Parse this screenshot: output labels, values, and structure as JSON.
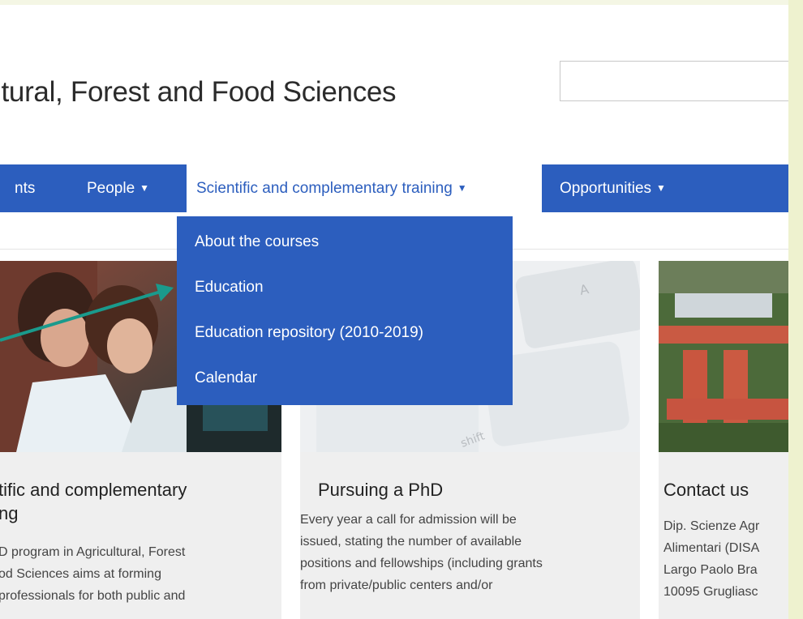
{
  "header": {
    "title": "ltural, Forest and Food Sciences",
    "search_placeholder": ""
  },
  "nav": {
    "items": [
      {
        "label": "nts"
      },
      {
        "label": "People"
      },
      {
        "label": "Scientific and complementary training"
      },
      {
        "label": "Opportunities"
      }
    ]
  },
  "dropdown": {
    "items": [
      {
        "label": "About the courses"
      },
      {
        "label": "Education"
      },
      {
        "label": "Education repository (2010-2019)"
      },
      {
        "label": "Calendar"
      }
    ]
  },
  "cards": [
    {
      "title_line1": "tific and complementary",
      "title_line2": "ng",
      "text": [
        "D program in Agricultural, Forest",
        "od Sciences aims at forming",
        "professionals for both public and"
      ]
    },
    {
      "title": "Pursuing a PhD",
      "text": [
        "Every year a call for admission will be",
        "issued, stating the number of available",
        "positions and fellowships (including grants",
        "from private/public centers and/or"
      ]
    },
    {
      "title": "Contact us",
      "text": [
        "Dip. Scienze Agr",
        "Alimentari (DISA",
        "Largo Paolo Bra",
        "10095 Grugliasc"
      ]
    }
  ],
  "colors": {
    "nav_blue": "#2c5ebe",
    "arrow_teal": "#1a9a8c",
    "frame_bg": "#eef2cf"
  },
  "keyboard_key_labels": [
    "A",
    "shift"
  ]
}
